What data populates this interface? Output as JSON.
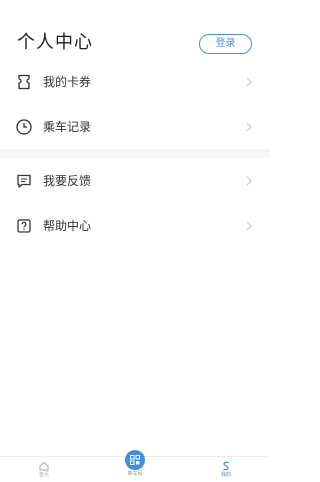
{
  "header": {
    "title": "个人中心",
    "login_label": "登录"
  },
  "menu": [
    {
      "label": "我的卡券",
      "icon": "ticket-icon"
    },
    {
      "label": "乘车记录",
      "icon": "clock-icon"
    },
    {
      "label": "我要反馈",
      "icon": "feedback-icon"
    },
    {
      "label": "帮助中心",
      "icon": "help-icon"
    }
  ],
  "tabbar": {
    "home_label": "首页",
    "scan_label": "乘车码",
    "mine_label": "我的",
    "active": "mine"
  },
  "colors": {
    "accent": "#4a90e2",
    "center_button": "#3d8fe6",
    "divider": "#f6f6f6"
  }
}
